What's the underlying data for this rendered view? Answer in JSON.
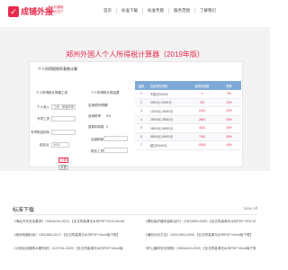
{
  "header": {
    "logo_char": "✓",
    "logo_text": "成铺外报",
    "logo_sub1": "专业化模版",
    "logo_sub2": "品牌化生产",
    "nav": [
      "首页",
      "标准下载",
      "标准专题",
      "服务范围",
      "了解我们"
    ]
  },
  "hero": {
    "title": "郑州外国人个人所得税计算器（2019年版）"
  },
  "calc": {
    "card_head": "个人所得税税率基数计算",
    "left_head": "个人所得税计算器工资",
    "right_head": "个人所得税计算结果",
    "labels": [
      "个人收入",
      "专项工资",
      "专项附加扣除",
      "起征点"
    ],
    "income_type": "工资、薪金所得",
    "threshold": "5000",
    "calc_button": "计算",
    "reset_button": "重置",
    "results": [
      {
        "label": "应纳税所得额",
        "value": "0"
      },
      {
        "label": "适用税率",
        "value": "0%"
      },
      {
        "label": "速算扣除数",
        "value": "0"
      },
      {
        "label": "应缴税款",
        "value": ""
      },
      {
        "label": "税后工资",
        "value": ""
      }
    ]
  },
  "table": {
    "headers": [
      "级数",
      "应纳税所得额",
      "速算扣除数",
      "税率"
    ],
    "rows": [
      {
        "level": "1",
        "range": "不超过3000元",
        "deduct": "0",
        "rate": "3%"
      },
      {
        "level": "2",
        "range": "3000元-12000元",
        "deduct": "210",
        "rate": "10%"
      },
      {
        "level": "3",
        "range": "12000元-25000元",
        "deduct": "1410",
        "rate": "20%"
      },
      {
        "level": "4",
        "range": "25000元-35000元",
        "deduct": "2660",
        "rate": "25%"
      },
      {
        "level": "5",
        "range": "35000元-55000元",
        "deduct": "4410",
        "rate": "30%"
      },
      {
        "level": "6",
        "range": "55000元-80000元",
        "deduct": "7160",
        "rate": "35%"
      },
      {
        "level": "7",
        "range": "超过80000元",
        "deduct": "15160",
        "rate": "45%"
      }
    ]
  },
  "downloads": {
    "title": "标准下载",
    "more": "View All",
    "items": [
      "《海运汽车安全要求》（GB16194-2021）【全文附高清无水印PDF+DOC/Word版...",
      "《漏电保护器安装和运行》（GB13955-2005）【全文附高清无水印PDF+DOC/Word...",
      "《家用电器标准》（GB1883-2017）【全文附高清无水印PDF+Word版下载】",
      "《通用分析方法》（GB13954-2009）【全文附高清无水印PDF+Word版下载】",
      "《大型民用建筑水暖系统》（GJT201-2020）【全文附高清无水印PDF+Word版...",
      "《矿山通风安全规程》（GB16423-2020）【全文附高清无水印PDF+Word版下载】"
    ]
  }
}
